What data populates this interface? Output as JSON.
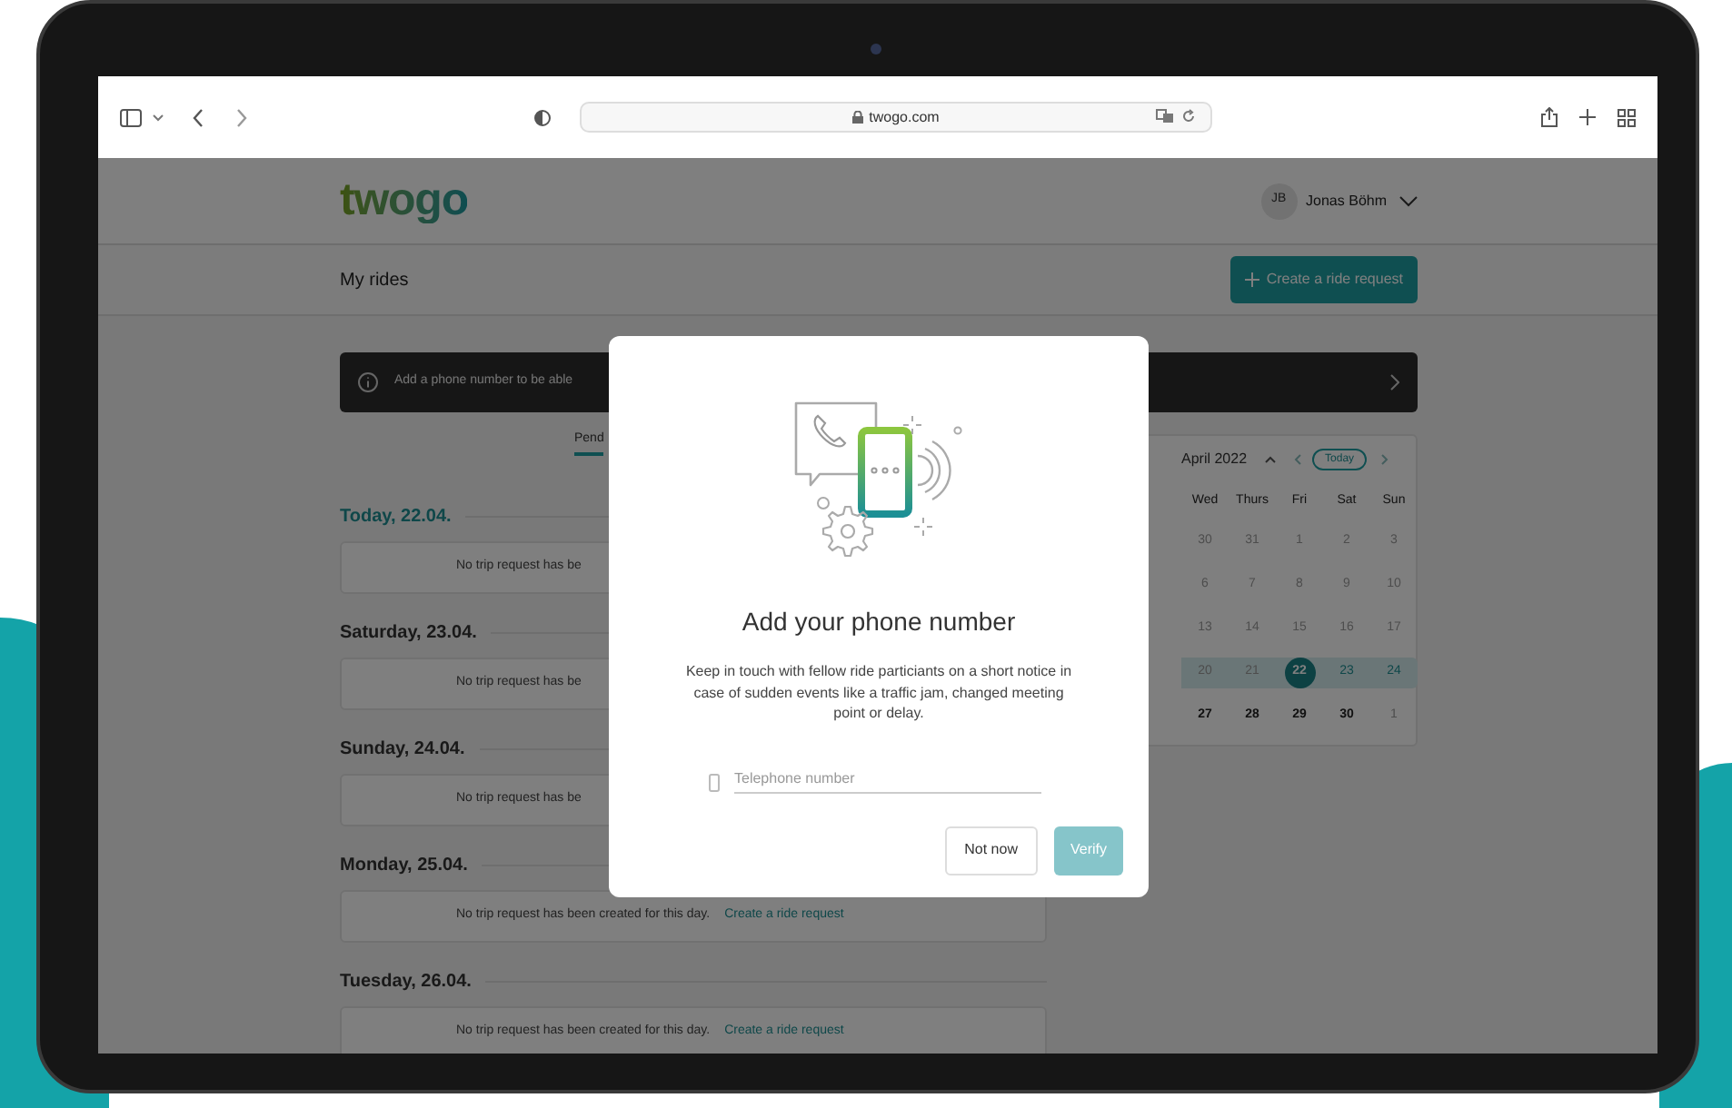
{
  "browser": {
    "address": "twogo.com"
  },
  "header": {
    "logo": "twogo",
    "user": {
      "initials": "JB",
      "name": "Jonas Böhm"
    }
  },
  "subheader": {
    "title": "My rides",
    "create_button": "Create a ride request"
  },
  "banner": {
    "text": "Add a phone number to be able"
  },
  "tabs": [
    {
      "label": "Pend",
      "selected": true
    }
  ],
  "days": [
    {
      "title": "Today, 22.04.",
      "today": true,
      "message": "No trip request has be"
    },
    {
      "title": "Saturday, 23.04.",
      "today": false,
      "message": "No trip request has be"
    },
    {
      "title": "Sunday, 24.04.",
      "today": false,
      "message": "No trip request has be"
    },
    {
      "title": "Monday, 25.04.",
      "today": false,
      "message": "No trip request has been created for this day.",
      "link": "Create a ride request"
    },
    {
      "title": "Tuesday, 26.04.",
      "today": false,
      "message": "No trip request has been created for this day.",
      "link": "Create a ride request"
    }
  ],
  "calendar": {
    "month": "April 2022",
    "today_button": "Today",
    "weekdays": [
      "Wed",
      "Thurs",
      "Fri",
      "Sat",
      "Sun"
    ],
    "weeks": [
      {
        "selected": false,
        "days": [
          {
            "label": "30",
            "kind": "past"
          },
          {
            "label": "31",
            "kind": "past"
          },
          {
            "label": "1",
            "kind": "past"
          },
          {
            "label": "2",
            "kind": "past"
          },
          {
            "label": "3",
            "kind": "past"
          }
        ]
      },
      {
        "selected": false,
        "days": [
          {
            "label": "6",
            "kind": "past"
          },
          {
            "label": "7",
            "kind": "past"
          },
          {
            "label": "8",
            "kind": "past"
          },
          {
            "label": "9",
            "kind": "past"
          },
          {
            "label": "10",
            "kind": "past"
          }
        ]
      },
      {
        "selected": false,
        "days": [
          {
            "label": "13",
            "kind": "past"
          },
          {
            "label": "14",
            "kind": "past"
          },
          {
            "label": "15",
            "kind": "past"
          },
          {
            "label": "16",
            "kind": "past"
          },
          {
            "label": "17",
            "kind": "past"
          }
        ]
      },
      {
        "selected": true,
        "days": [
          {
            "label": "20",
            "kind": "past"
          },
          {
            "label": "21",
            "kind": "past"
          },
          {
            "label": "22",
            "kind": "today"
          },
          {
            "label": "23",
            "kind": "upcoming"
          },
          {
            "label": "24",
            "kind": "upcoming"
          }
        ]
      },
      {
        "selected": false,
        "days": [
          {
            "label": "27",
            "kind": "future"
          },
          {
            "label": "28",
            "kind": "future"
          },
          {
            "label": "29",
            "kind": "future"
          },
          {
            "label": "30",
            "kind": "future"
          },
          {
            "label": "1",
            "kind": "outside"
          }
        ]
      }
    ]
  },
  "modal": {
    "title": "Add your phone number",
    "description": "Keep in touch with fellow ride particiants on a short notice in case of sudden events like a traffic jam, changed meeting point or delay.",
    "phone_field": {
      "placeholder": "Telephone number"
    },
    "buttons": [
      {
        "label": "Not now",
        "kind": "secondary",
        "disabled": false
      },
      {
        "label": "Verify",
        "kind": "primary",
        "disabled": true
      }
    ]
  }
}
